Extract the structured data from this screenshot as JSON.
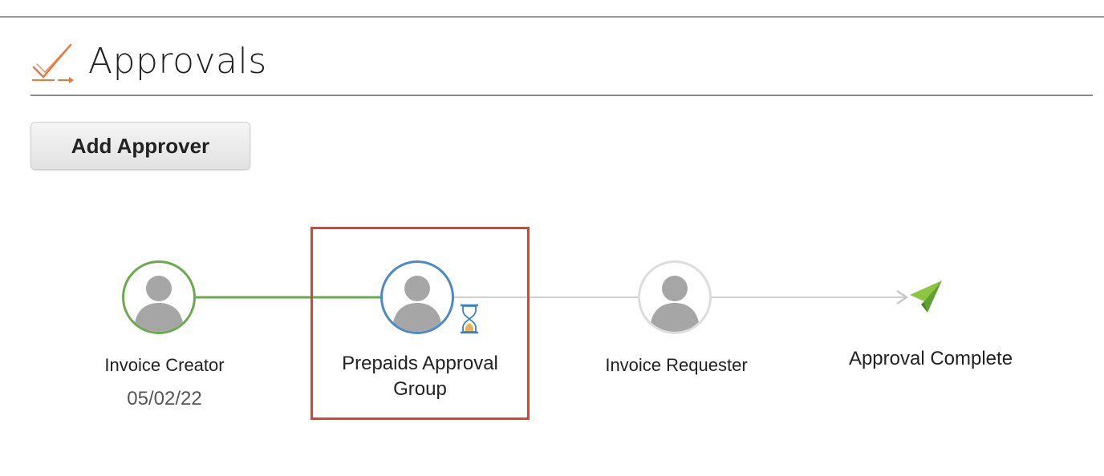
{
  "header": {
    "title": "Approvals",
    "icon": "approval-check-icon"
  },
  "toolbar": {
    "add_approver_label": "Add Approver"
  },
  "workflow": {
    "steps": [
      {
        "label": "Invoice Creator",
        "date": "05/02/22",
        "status": "completed",
        "ring_color": "#6aaa4e"
      },
      {
        "label_line1": "Prepaids Approval",
        "label_line2": "Group",
        "status": "pending",
        "ring_color": "#4a8ac8",
        "status_icon": "hourglass-icon",
        "highlighted": true,
        "highlight_color": "#e0412c"
      },
      {
        "label": "Invoice Requester",
        "status": "upcoming",
        "ring_color": "#dddddd"
      },
      {
        "label": "Approval Complete",
        "status": "final",
        "icon": "paper-plane-icon",
        "icon_color": "#6db33f"
      }
    ],
    "connector_done_color": "#6aaa4e",
    "connector_pending_color": "#d0d0d0"
  }
}
